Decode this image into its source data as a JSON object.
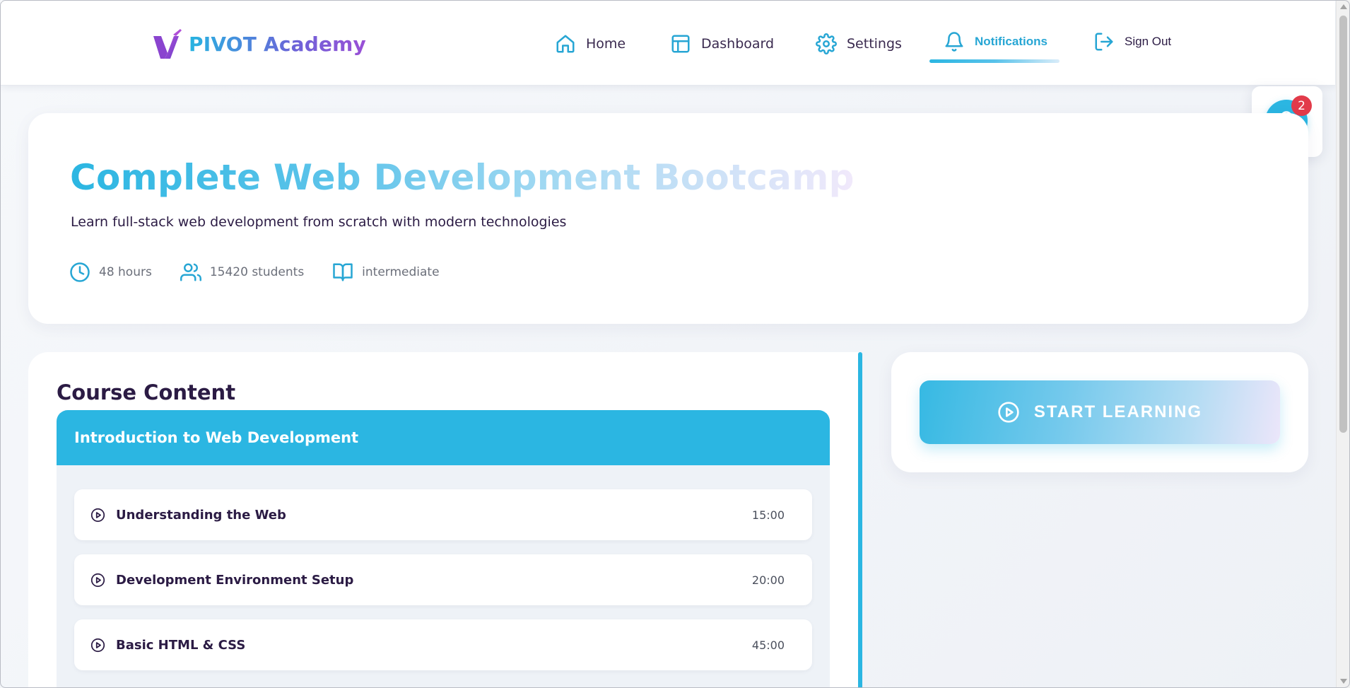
{
  "brand": {
    "name": "PIVOT Academy"
  },
  "nav": {
    "items": [
      {
        "label": "Home",
        "icon": "home-icon"
      },
      {
        "label": "Dashboard",
        "icon": "dashboard-icon"
      },
      {
        "label": "Settings",
        "icon": "gear-icon"
      },
      {
        "label": "Notifications",
        "icon": "bell-icon",
        "active": true
      },
      {
        "label": "Sign Out",
        "icon": "sign-out-icon"
      }
    ]
  },
  "notifications": {
    "count": "2",
    "icon": "bell-icon"
  },
  "course": {
    "title": "Complete Web Development Bootcamp",
    "subtitle": "Learn full-stack web development from scratch with modern technologies",
    "meta": {
      "duration": "48 hours",
      "students": "15420 students",
      "level": "intermediate"
    }
  },
  "content": {
    "heading": "Course Content",
    "modules": [
      {
        "title": "Introduction to Web Development",
        "lessons": [
          {
            "title": "Understanding the Web",
            "duration": "15:00"
          },
          {
            "title": "Development Environment Setup",
            "duration": "20:00"
          },
          {
            "title": "Basic HTML & CSS",
            "duration": "45:00"
          }
        ]
      }
    ]
  },
  "actions": {
    "start_label": "START LEARNING"
  },
  "colors": {
    "accent": "#2bb6e2",
    "brand_purple": "#9a4fd6",
    "text_dark": "#2b1b44",
    "badge_red": "#e23b4a"
  }
}
